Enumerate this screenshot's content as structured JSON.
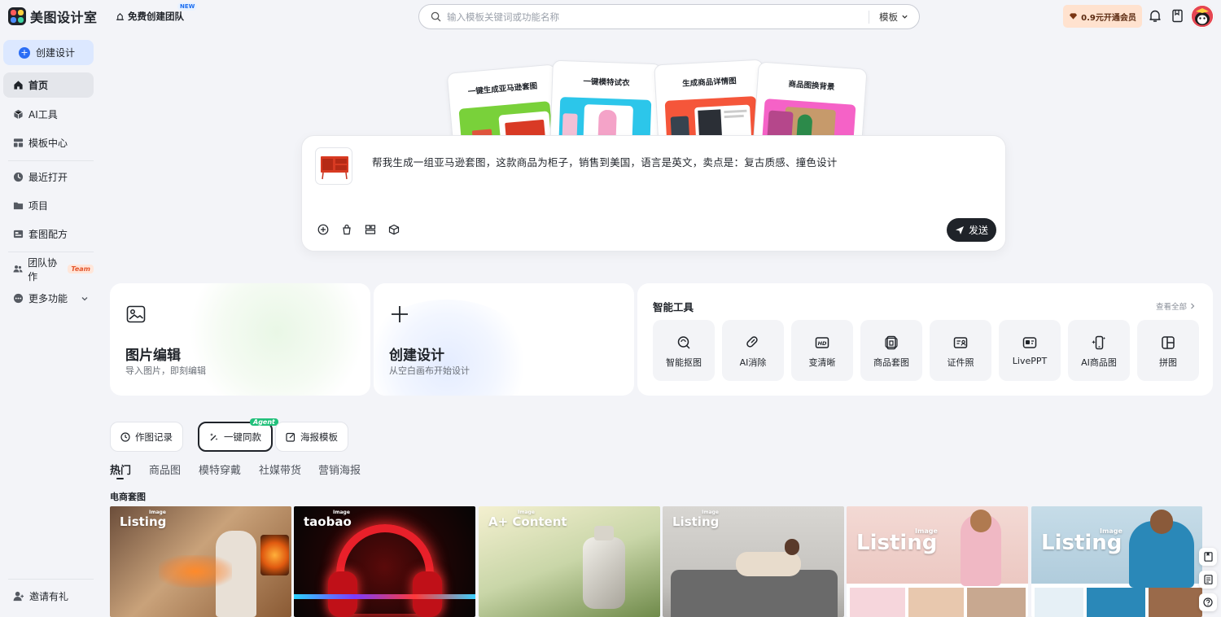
{
  "app": {
    "name": "美图设计室"
  },
  "header": {
    "team_create": "免费创建团队",
    "new_badge": "NEW",
    "search_placeholder": "输入模板关键词或功能名称",
    "search_scope": "模板",
    "vip_label": "0.9元开通会员"
  },
  "sidebar": {
    "create_label": "创建设计",
    "items": [
      {
        "label": "首页",
        "icon": "home-icon"
      },
      {
        "label": "AI工具",
        "icon": "cube-icon"
      },
      {
        "label": "模板中心",
        "icon": "template-icon"
      },
      {
        "label": "最近打开",
        "icon": "clock-icon"
      },
      {
        "label": "项目",
        "icon": "folder-icon"
      },
      {
        "label": "套图配方",
        "icon": "recipe-icon"
      },
      {
        "label": "团队协作",
        "icon": "team-icon",
        "tag": "Team"
      },
      {
        "label": "更多功能",
        "icon": "more-icon"
      }
    ],
    "invite_label": "邀请有礼"
  },
  "hero": {
    "cards": [
      {
        "title": "一键生成亚马逊套图",
        "color": "#79d13a"
      },
      {
        "title": "一键模特试衣",
        "color": "#2cc6ea"
      },
      {
        "title": "生成商品详情图",
        "color": "#f5563a"
      },
      {
        "title": "商品图换背景",
        "color": "#f562c7"
      }
    ]
  },
  "prompt": {
    "text": "帮我生成一组亚马逊套图，这款商品为柜子，销售到美国，语言是英文，卖点是：复古质感、撞色设计",
    "send_label": "发送"
  },
  "features": {
    "image_edit": {
      "title": "图片编辑",
      "subtitle": "导入图片，即刻编辑"
    },
    "create": {
      "title": "创建设计",
      "subtitle": "从空白画布开始设计"
    },
    "tools": {
      "title": "智能工具",
      "view_all": "查看全部",
      "items": [
        {
          "label": "智能抠图",
          "icon": "cutout-icon"
        },
        {
          "label": "AI消除",
          "icon": "eraser-icon"
        },
        {
          "label": "变清晰",
          "icon": "hd-icon"
        },
        {
          "label": "商品套图",
          "icon": "product-set-icon"
        },
        {
          "label": "证件照",
          "icon": "id-photo-icon"
        },
        {
          "label": "LivePPT",
          "icon": "ppt-icon"
        },
        {
          "label": "AI商品图",
          "icon": "ai-product-icon"
        },
        {
          "label": "拼图",
          "icon": "collage-icon"
        }
      ]
    }
  },
  "tabs": {
    "pills": [
      {
        "label": "作图记录"
      },
      {
        "label": "一键同款",
        "badge": "Agent"
      },
      {
        "label": "海报模板"
      }
    ],
    "categories": [
      "热门",
      "商品图",
      "模特穿戴",
      "社媒带货",
      "营销海报"
    ],
    "section_title": "电商套图"
  },
  "gallery": [
    {
      "tag": "Listing",
      "sub": "Image"
    },
    {
      "tag": "taobao",
      "sub": "Image"
    },
    {
      "tag": "A+ Content",
      "sub": "Image"
    },
    {
      "tag": "Listing",
      "sub": "Image"
    },
    {
      "tag": "Listing",
      "sub": "Image"
    },
    {
      "tag": "Listing",
      "sub": "Image"
    }
  ]
}
